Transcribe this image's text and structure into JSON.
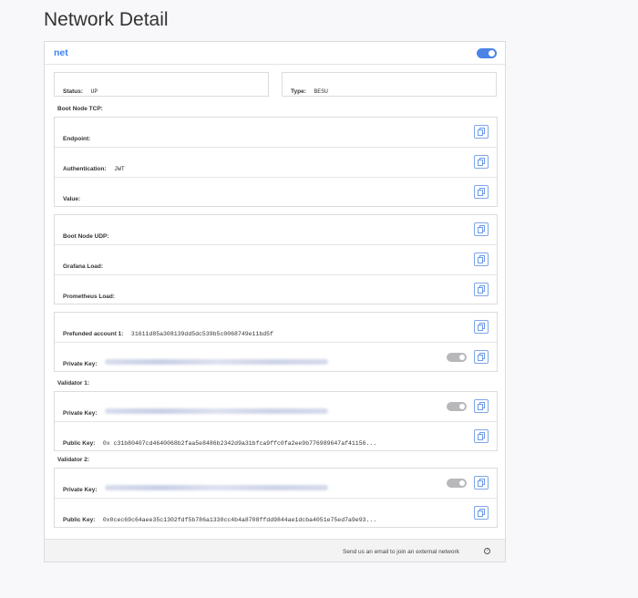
{
  "page": {
    "title": "Network Detail"
  },
  "network": {
    "name": "net",
    "enabled": true
  },
  "status": {
    "label": "Status:",
    "value": "UP"
  },
  "type": {
    "label": "Type:",
    "value": "BESU"
  },
  "boot_node_tcp": {
    "section_label": "Boot Node TCP:",
    "endpoint_label": "Endpoint:",
    "authentication_label": "Authentication:",
    "authentication_value": "JWT",
    "value_label": "Value:"
  },
  "services": {
    "boot_node_udp_label": "Boot Node UDP:",
    "grafana_label": "Grafana Load:",
    "prometheus_label": "Prometheus Load:"
  },
  "prefunded": {
    "label": "Prefunded account 1:",
    "value": "31611d85a308139dd5dc539b5c0068749e11bd5f",
    "private_key_label": "Private Key:",
    "private_key_hidden": true
  },
  "validators": [
    {
      "section_label": "Validator 1:",
      "private_key_label": "Private Key:",
      "private_key_hidden": true,
      "public_key_label": "Public Key:",
      "public_key_value": "0x c31b80407cd4640068b2faa5e8486b2342d9a31bfca9ffc0fa2ee9b776989647af41156..."
    },
    {
      "section_label": "Validator 2:",
      "private_key_label": "Private Key:",
      "private_key_hidden": true,
      "public_key_label": "Public Key:",
      "public_key_value": "0x0cec69c64aee35c1302fdf5b786a1330cc4b4a8708ffdd9844ae1dcba4051e75ed7a9e93..."
    }
  ],
  "footer": {
    "email_text": "Send us an email to join an external network",
    "help_icon": "question-circle-icon"
  },
  "icons": {
    "copy": "copy-icon"
  },
  "colors": {
    "accent": "#4a84e6",
    "link": "#3b82f6"
  }
}
